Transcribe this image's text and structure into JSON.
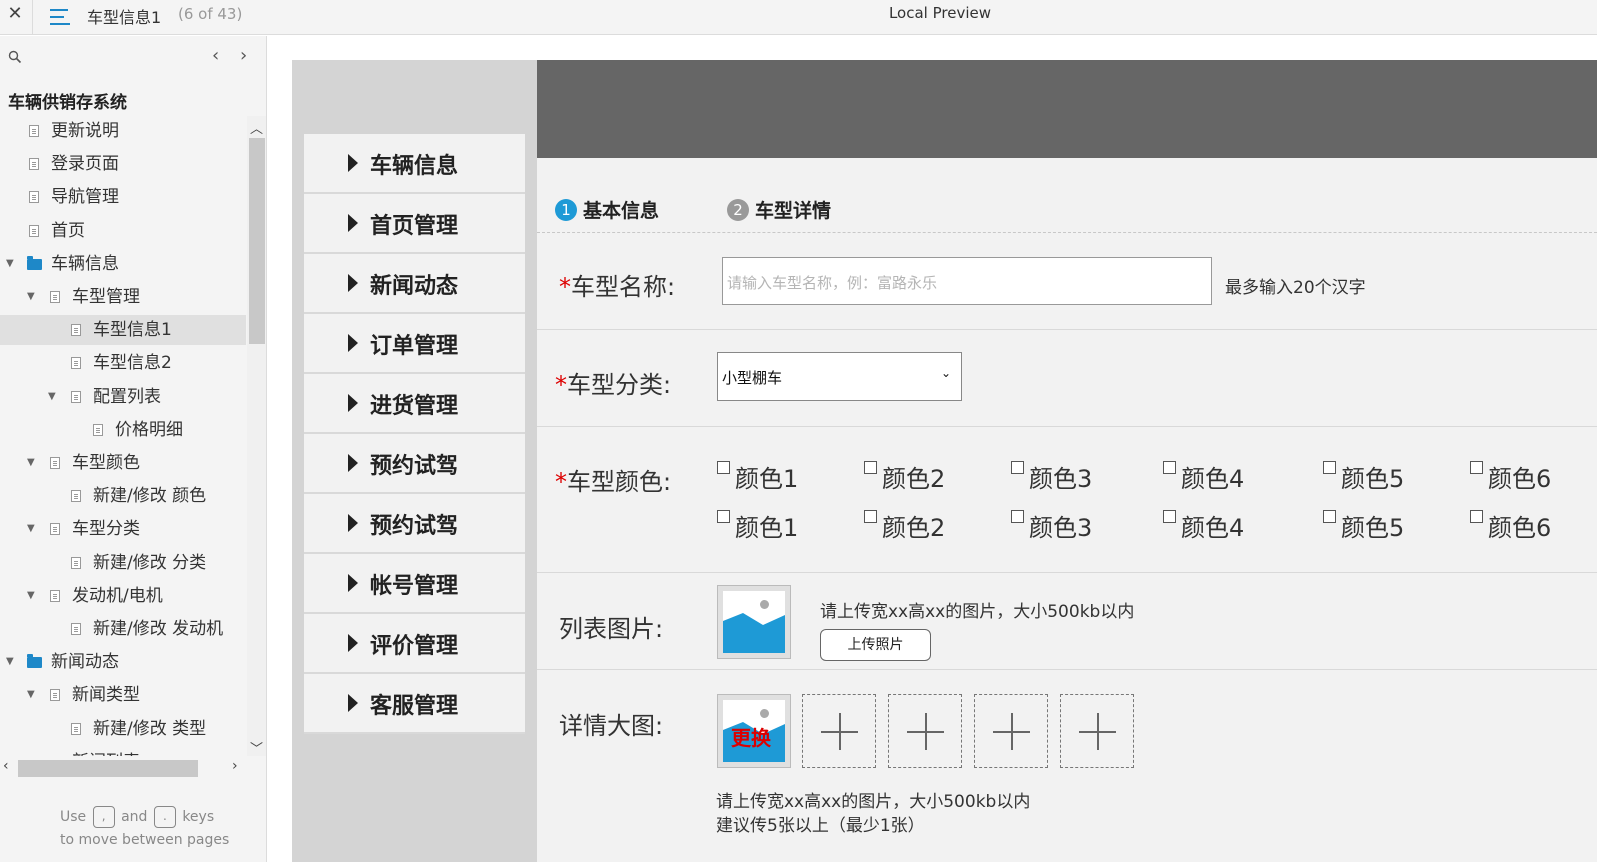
{
  "topbar": {
    "close_icon": "close-icon",
    "menu_icon": "hamburger-menu-icon",
    "page_title": "车型信息1",
    "page_count": "(6 of 43)",
    "center_title": "Local Preview"
  },
  "sidebar": {
    "project_title": "车辆供销存系统",
    "nav_prev": "‹",
    "nav_next": "›",
    "tree": [
      {
        "label": "更新说明",
        "type": "page",
        "level": 0
      },
      {
        "label": "登录页面",
        "type": "page",
        "level": 0
      },
      {
        "label": "导航管理",
        "type": "page",
        "level": 0
      },
      {
        "label": "首页",
        "type": "page",
        "level": 0
      },
      {
        "label": "车辆信息",
        "type": "folder",
        "level": 0,
        "expanded": true
      },
      {
        "label": "车型管理",
        "type": "page",
        "level": 1,
        "expanded": true
      },
      {
        "label": "车型信息1",
        "type": "page",
        "level": 2,
        "selected": true
      },
      {
        "label": "车型信息2",
        "type": "page",
        "level": 2
      },
      {
        "label": "配置列表",
        "type": "page",
        "level": 2,
        "expanded": true
      },
      {
        "label": "价格明细",
        "type": "page",
        "level": 3
      },
      {
        "label": "车型颜色",
        "type": "page",
        "level": 1,
        "expanded": true
      },
      {
        "label": "新建/修改 颜色",
        "type": "page",
        "level": 2
      },
      {
        "label": "车型分类",
        "type": "page",
        "level": 1,
        "expanded": true
      },
      {
        "label": "新建/修改 分类",
        "type": "page",
        "level": 2
      },
      {
        "label": "发动机/电机",
        "type": "page",
        "level": 1,
        "expanded": true
      },
      {
        "label": "新建/修改 发动机",
        "type": "page",
        "level": 2
      },
      {
        "label": "新闻动态",
        "type": "folder",
        "level": 0,
        "expanded": true
      },
      {
        "label": "新闻类型",
        "type": "page",
        "level": 1,
        "expanded": true
      },
      {
        "label": "新建/修改 类型",
        "type": "page",
        "level": 2
      },
      {
        "label": "新闻列表",
        "type": "page",
        "level": 1
      }
    ],
    "hint_use": "Use",
    "hint_and": "and",
    "hint_keys": "keys",
    "hint_key_prev": ",",
    "hint_key_next": ".",
    "hint_line2": "to move between pages"
  },
  "proto": {
    "menu": [
      "车辆信息",
      "首页管理",
      "新闻动态",
      "订单管理",
      "进货管理",
      "预约试驾",
      "预约试驾",
      "帐号管理",
      "评价管理",
      "客服管理"
    ],
    "steps": [
      {
        "num": "1",
        "label": "基本信息",
        "color": "#1e9ad6"
      },
      {
        "num": "2",
        "label": "车型详情",
        "color": "#999999"
      }
    ],
    "form": {
      "required_mark": "*",
      "name_label": "车型名称:",
      "name_placeholder": "请输入车型名称，例：富路永乐",
      "name_note": "最多输入20个汉字",
      "category_label": "车型分类:",
      "category_value": "小型棚车",
      "color_label": "车型颜色:",
      "colors_row1": [
        "颜色1",
        "颜色2",
        "颜色3",
        "颜色4",
        "颜色5",
        "颜色6"
      ],
      "colors_row2": [
        "颜色1",
        "颜色2",
        "颜色3",
        "颜色4",
        "颜色5",
        "颜色6"
      ],
      "list_image_label": "列表图片:",
      "list_image_note": "请上传宽xx高xx的图片，大小500kb以内",
      "upload_button": "上传照片",
      "detail_image_label": "详情大图:",
      "replace_label": "更换",
      "detail_note1": "请上传宽xx高xx的图片，大小500kb以内",
      "detail_note2": "建议传5张以上（最少1张）"
    }
  }
}
